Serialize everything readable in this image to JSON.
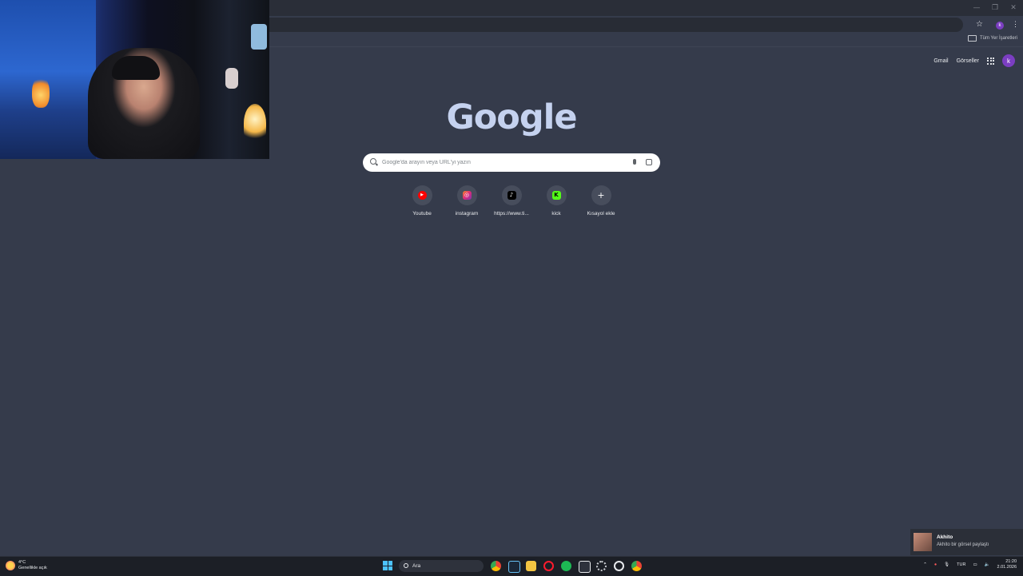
{
  "browser": {
    "omnibox_placeholder": "",
    "profile_initial": "k",
    "bookmarks_all_label": "Tüm Yer İşaretleri"
  },
  "ntp": {
    "logo": "Google",
    "search_placeholder": "Google'da arayın veya URL'yi yazın",
    "top_links": {
      "gmail": "Gmail",
      "images": "Görseller"
    },
    "avatar_initial": "k",
    "shortcuts": [
      {
        "label": "Youtube",
        "icon": "youtube-icon",
        "color": "#ff0000",
        "glyph": "▶"
      },
      {
        "label": "instagram",
        "icon": "instagram-icon",
        "color": "#d6249f",
        "glyph": "◎"
      },
      {
        "label": "https://www.ti...",
        "icon": "tiktok-icon",
        "color": "#000000",
        "glyph": "♪"
      },
      {
        "label": "kick",
        "icon": "kick-icon",
        "color": "#53fc18",
        "glyph": "K"
      },
      {
        "label": "Kısayol ekle",
        "icon": "add-icon",
        "color": "#474d5c",
        "glyph": "+"
      }
    ]
  },
  "notification": {
    "title": "Akhito",
    "text": "Akhito bir görsel paylaştı"
  },
  "taskbar": {
    "weather_temp": "4°C",
    "weather_desc": "Genellikle açık",
    "search_label": "Ara",
    "language": "TUR",
    "time": "21:20",
    "date": "2.01.2026"
  }
}
